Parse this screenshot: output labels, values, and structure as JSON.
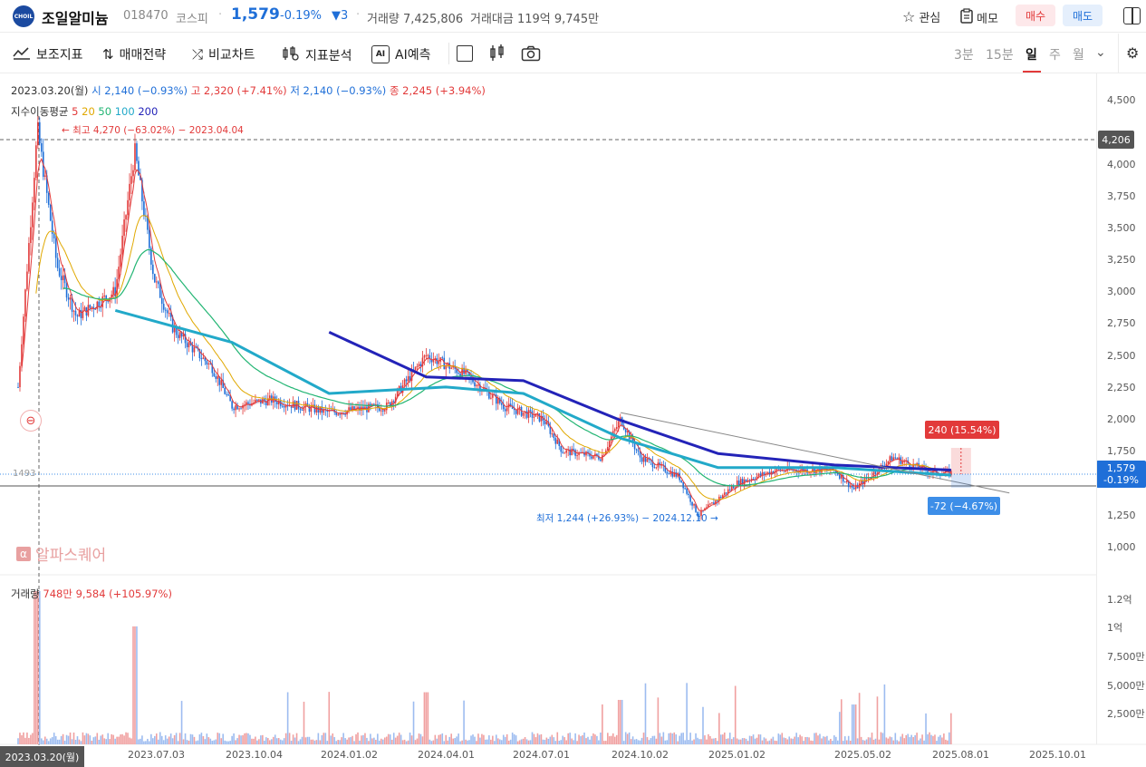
{
  "header": {
    "logo_text": "CHOIL",
    "stock_name": "조일알미늄",
    "stock_code": "018470",
    "market": "코스피",
    "price": "1,579",
    "change_pct": "-0.19%",
    "change_abs": "3",
    "volume": "거래량 7,425,806",
    "trade_amount": "거래대금 119억 9,745만",
    "watch_label": "관심",
    "memo_label": "메모",
    "buy_label": "매수",
    "sell_label": "매도"
  },
  "toolbar": {
    "indicator": "보조지표",
    "strategy": "매매전략",
    "compare": "비교차트",
    "analysis": "지표분석",
    "ai_predict": "AI예측",
    "ai_chip": "AI",
    "periods": [
      "3분",
      "15분",
      "일",
      "주",
      "월"
    ],
    "active_period": "일"
  },
  "chart_info": {
    "date": "2023.03.20(월)",
    "open": "시 2,140 (−0.93%)",
    "high": "고 2,320 (+7.41%)",
    "low": "저 2,140 (−0.93%)",
    "close": "종 2,245 (+3.94%)",
    "ema_label": "지수이동평균",
    "ema_periods": [
      "5",
      "20",
      "50",
      "100",
      "200"
    ],
    "high_marker": "최고 4,270 (−63.02%) − 2023.04.04",
    "low_marker": "최저 1,244 (+26.93%) − 2024.12.10",
    "left_edge_value": "1493",
    "up_box": "240 (15.54%)",
    "down_box": "-72 (−4.67%)",
    "crosshair_price": "4,206",
    "last_price": "1,579",
    "last_change": "-0.19%",
    "watermark": "알파스퀘어",
    "volume_label": "거래량",
    "volume_value": "748만 9,584 (+105.97%)"
  },
  "colors": {
    "up": "#e23a3a",
    "down": "#1f6fd8",
    "ema5": "#e23a3a",
    "ema20": "#e0a800",
    "ema50": "#22b573",
    "ema100": "#22a9c9",
    "ema200": "#2323b8"
  },
  "yaxis": [
    "4,500",
    "4,000",
    "3,750",
    "3,500",
    "3,250",
    "3,000",
    "2,750",
    "2,500",
    "2,250",
    "2,000",
    "1,750",
    "1,250",
    "1,000"
  ],
  "vol_axis": [
    "1.2억",
    "1억",
    "7,500만",
    "5,000만",
    "2,500만"
  ],
  "xaxis": {
    "selected": "2023.03.20(월)",
    "ticks": [
      "2023.07.03",
      "2023.10.04",
      "2024.01.02",
      "2024.04.01",
      "2024.07.01",
      "2024.10.02",
      "2025.01.02",
      "2025.05.02",
      "2025.08.01",
      "2025.10.01"
    ]
  },
  "chart_data": {
    "type": "line",
    "ylim": [
      1000,
      4500
    ],
    "price_path": [
      [
        2023.2,
        2250
      ],
      [
        2023.25,
        4270
      ],
      [
        2023.3,
        3200
      ],
      [
        2023.35,
        2800
      ],
      [
        2023.4,
        2900
      ],
      [
        2023.45,
        3000
      ],
      [
        2023.5,
        4100
      ],
      [
        2023.55,
        3100
      ],
      [
        2023.6,
        2700
      ],
      [
        2023.7,
        2400
      ],
      [
        2023.75,
        2100
      ],
      [
        2023.85,
        2150
      ],
      [
        2024.0,
        2050
      ],
      [
        2024.15,
        2100
      ],
      [
        2024.25,
        2500
      ],
      [
        2024.35,
        2350
      ],
      [
        2024.45,
        2100
      ],
      [
        2024.55,
        2000
      ],
      [
        2024.6,
        1750
      ],
      [
        2024.7,
        1700
      ],
      [
        2024.75,
        2000
      ],
      [
        2024.8,
        1700
      ],
      [
        2024.9,
        1550
      ],
      [
        2024.95,
        1244
      ],
      [
        2025.05,
        1500
      ],
      [
        2025.15,
        1600
      ],
      [
        2025.3,
        1600
      ],
      [
        2025.35,
        1450
      ],
      [
        2025.45,
        1700
      ],
      [
        2025.55,
        1580
      ],
      [
        2025.6,
        1579
      ]
    ],
    "ema200": [
      [
        2024.0,
        2680
      ],
      [
        2024.25,
        2330
      ],
      [
        2024.5,
        2300
      ],
      [
        2024.75,
        1990
      ],
      [
        2025.0,
        1730
      ],
      [
        2025.3,
        1640
      ],
      [
        2025.6,
        1600
      ]
    ],
    "ema100": [
      [
        2023.45,
        2850
      ],
      [
        2023.75,
        2600
      ],
      [
        2024.0,
        2200
      ],
      [
        2024.3,
        2250
      ],
      [
        2024.5,
        2200
      ],
      [
        2024.75,
        1850
      ],
      [
        2025.0,
        1620
      ],
      [
        2025.3,
        1620
      ],
      [
        2025.6,
        1560
      ]
    ],
    "trend_line": [
      [
        2024.75,
        2050
      ],
      [
        2025.75,
        1420
      ]
    ]
  }
}
